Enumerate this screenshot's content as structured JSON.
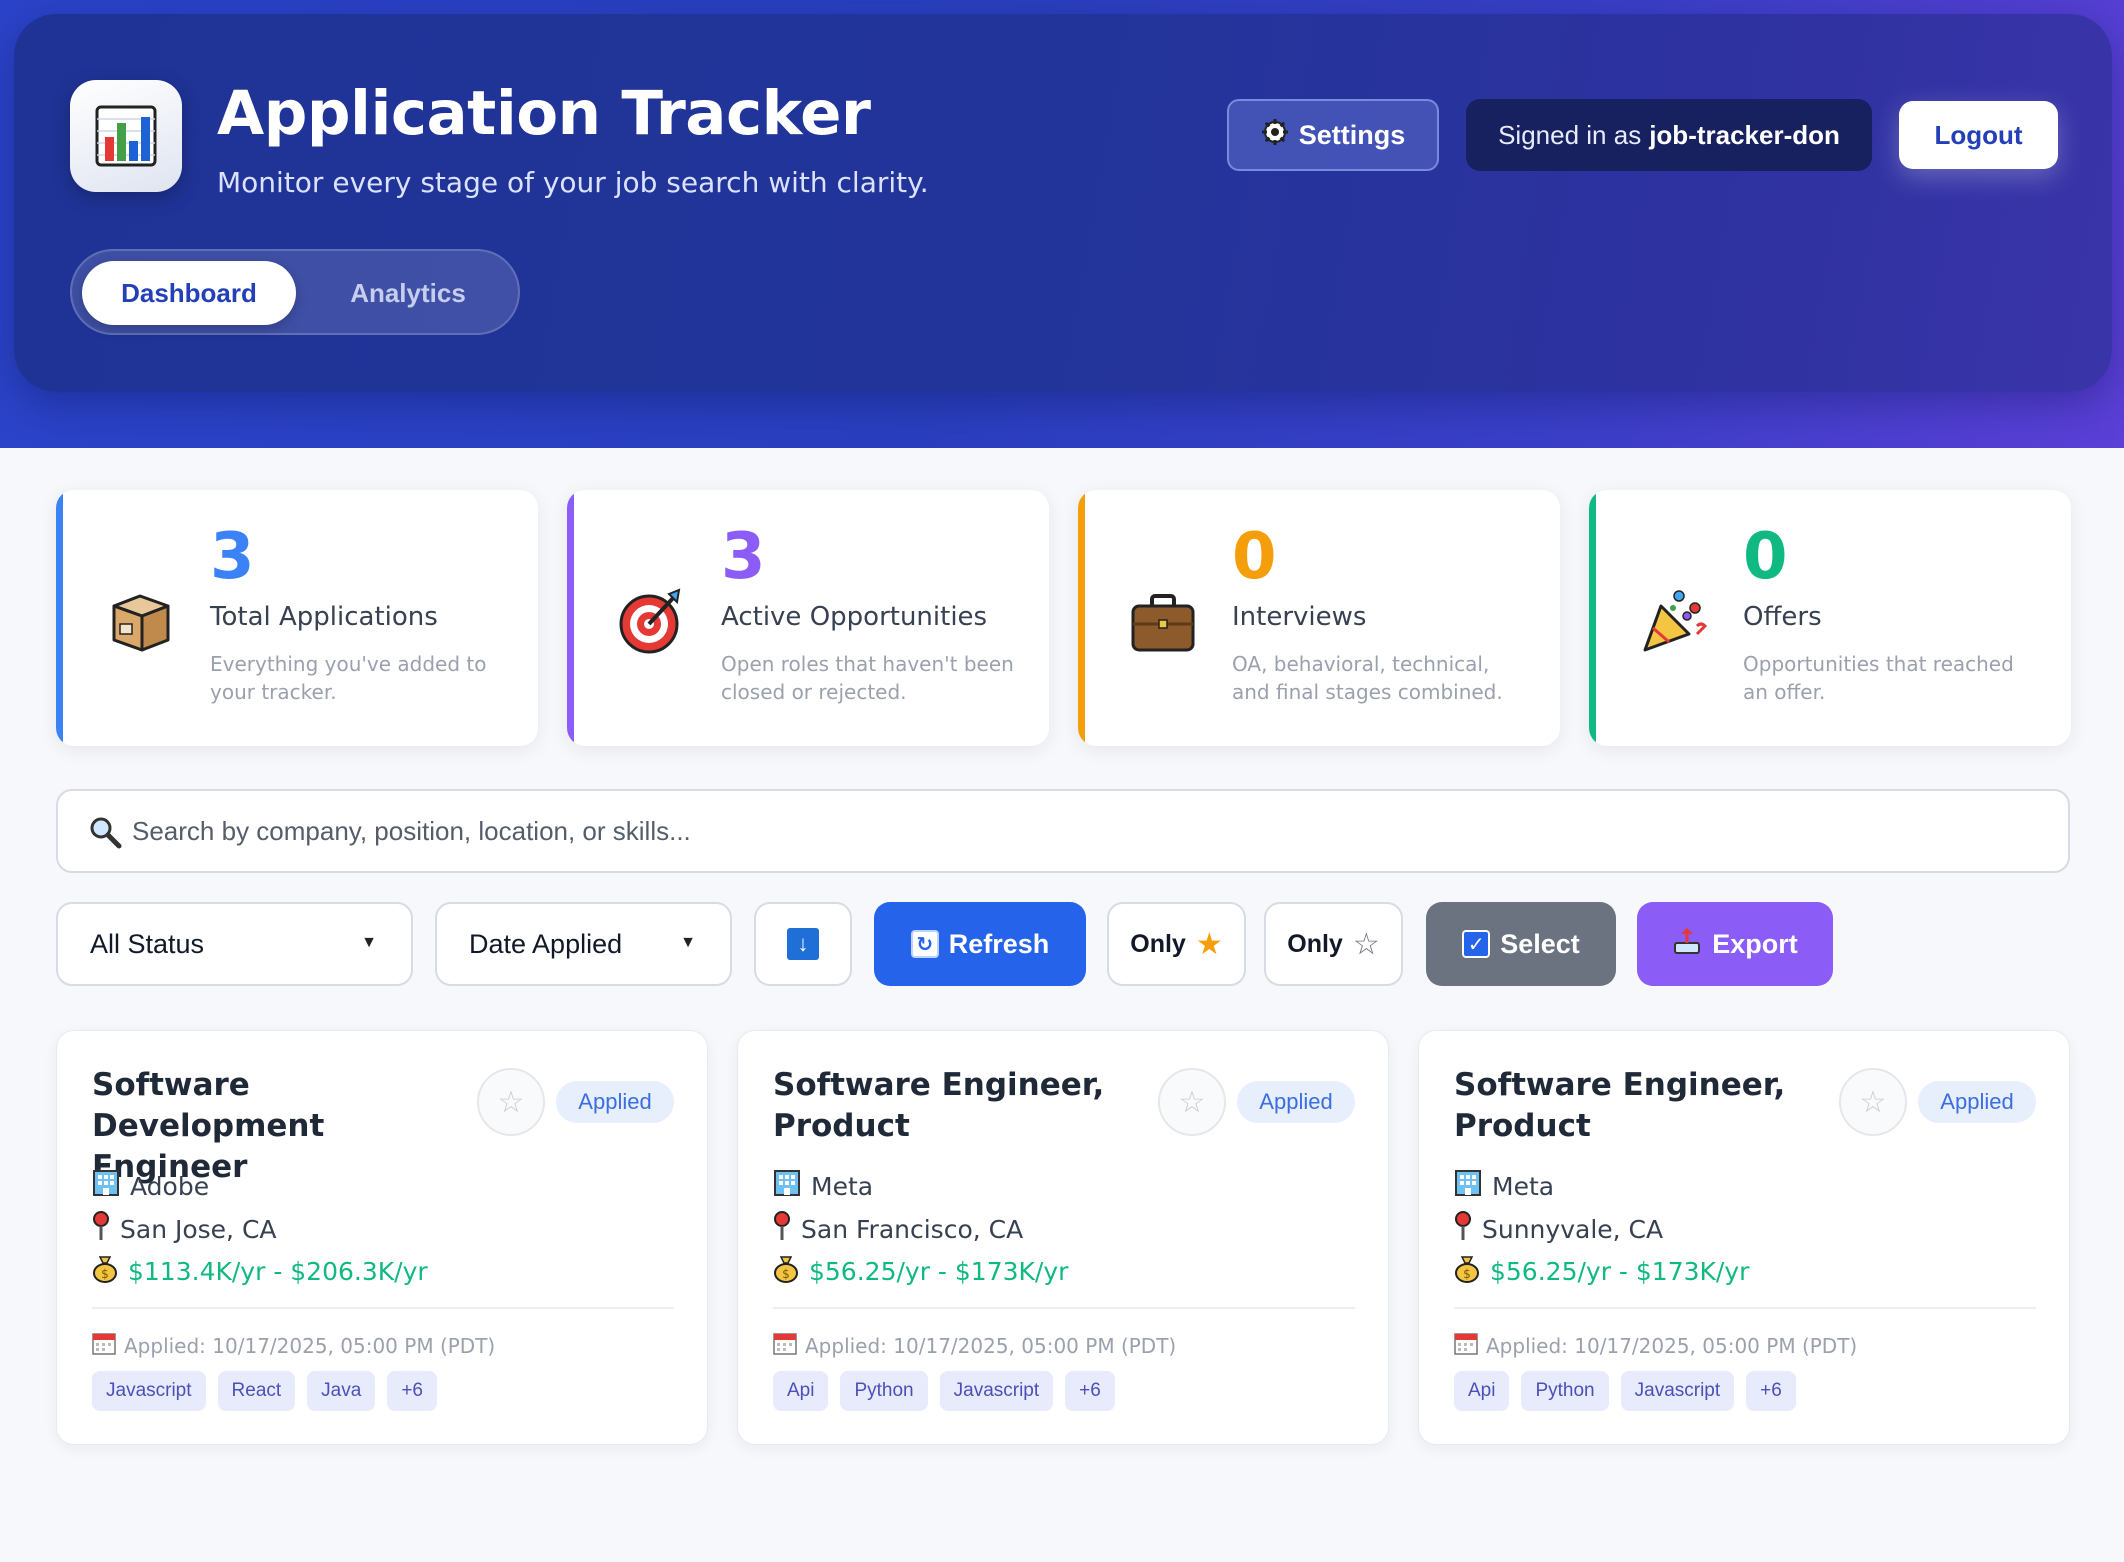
{
  "header": {
    "title": "Application Tracker",
    "subtitle": "Monitor every stage of your job search with clarity.",
    "logo_icon": "bar-chart-icon",
    "tabs": [
      {
        "label": "Dashboard",
        "active": true
      },
      {
        "label": "Analytics",
        "active": false
      }
    ],
    "settings_label": "Settings",
    "signed_in_prefix": "Signed in as",
    "username": "job-tracker-don",
    "logout_label": "Logout"
  },
  "stats": [
    {
      "value": "3",
      "label": "Total Applications",
      "desc": "Everything you've added to your tracker.",
      "color": "#3b82f6",
      "icon": "package-icon"
    },
    {
      "value": "3",
      "label": "Active Opportunities",
      "desc": "Open roles that haven't been closed or rejected.",
      "color": "#8b5cf6",
      "icon": "target-icon"
    },
    {
      "value": "0",
      "label": "Interviews",
      "desc": "OA, behavioral, technical, and final stages combined.",
      "color": "#f59e0b",
      "icon": "briefcase-icon"
    },
    {
      "value": "0",
      "label": "Offers",
      "desc": "Opportunities that reached an offer.",
      "color": "#10b981",
      "icon": "party-popper-icon"
    }
  ],
  "search": {
    "placeholder": "Search by company, position, location, or skills..."
  },
  "filters": {
    "status_value": "All Status",
    "sort_value": "Date Applied",
    "refresh_label": "Refresh",
    "only_starred_label": "Only",
    "only_unstarred_label": "Only",
    "select_label": "Select",
    "export_label": "Export"
  },
  "jobs": [
    {
      "title": "Software Development Engineer",
      "status": "Applied",
      "company": "Adobe",
      "location": "San Jose, CA",
      "salary": "$113.4K/yr - $206.3K/yr",
      "applied": "Applied: 10/17/2025, 05:00 PM (PDT)",
      "tags": [
        "Javascript",
        "React",
        "Java",
        "+6"
      ]
    },
    {
      "title": "Software Engineer, Product",
      "status": "Applied",
      "company": "Meta",
      "location": "San Francisco, CA",
      "salary": "$56.25/yr - $173K/yr",
      "applied": "Applied: 10/17/2025, 05:00 PM (PDT)",
      "tags": [
        "Api",
        "Python",
        "Javascript",
        "+6"
      ]
    },
    {
      "title": "Software Engineer, Product",
      "status": "Applied",
      "company": "Meta",
      "location": "Sunnyvale, CA",
      "salary": "$56.25/yr - $173K/yr",
      "applied": "Applied: 10/17/2025, 05:00 PM (PDT)",
      "tags": [
        "Api",
        "Python",
        "Javascript",
        "+6"
      ]
    }
  ],
  "colors": {
    "header_gradient_start": "#2b43c9",
    "accent_blue": "#2563eb",
    "export_purple": "#8b5cf6",
    "select_gray": "#6b7280",
    "salary_green": "#10b981"
  }
}
